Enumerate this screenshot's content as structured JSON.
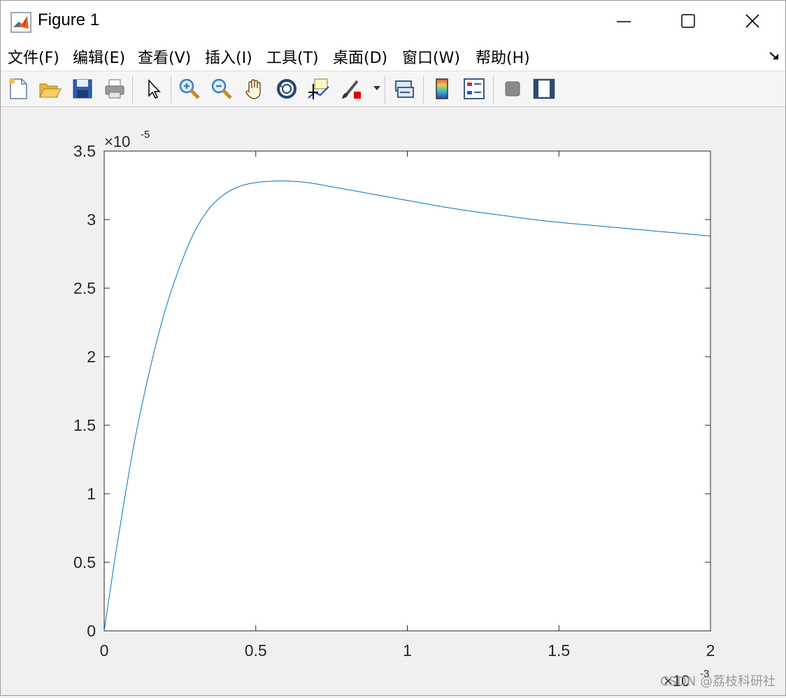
{
  "window": {
    "title": "Figure 1"
  },
  "menu": {
    "items": [
      {
        "label": "文件(F)"
      },
      {
        "label": "编辑(E)"
      },
      {
        "label": "查看(V)"
      },
      {
        "label": "插入(I)"
      },
      {
        "label": "工具(T)"
      },
      {
        "label": "桌面(D)"
      },
      {
        "label": "窗口(W)"
      },
      {
        "label": "帮助(H)"
      }
    ]
  },
  "toolbar": {
    "icons": [
      "new-figure-icon",
      "open-file-icon",
      "save-icon",
      "print-icon",
      "select-arrow-icon",
      "zoom-in-icon",
      "zoom-out-icon",
      "pan-hand-icon",
      "rotate-3d-icon",
      "data-cursor-icon",
      "brush-icon",
      "link-plot-icon",
      "colorbar-icon",
      "legend-icon",
      "hide-plot-tools-icon",
      "show-plot-tools-icon"
    ]
  },
  "watermark": "CSDN @荔枝科研社",
  "chart_data": {
    "type": "line",
    "title": "",
    "xlabel": "",
    "ylabel": "",
    "xlim": [
      0,
      0.002
    ],
    "ylim": [
      0,
      3.5e-05
    ],
    "x_exponent_label": "×10",
    "x_exponent": "-3",
    "y_exponent_label": "×10",
    "y_exponent": "-5",
    "x_tick_labels": [
      "0",
      "0.5",
      "1",
      "1.5",
      "2"
    ],
    "x_ticks": [
      0,
      0.0005,
      0.001,
      0.0015,
      0.002
    ],
    "y_tick_labels": [
      "0",
      "0.5",
      "1",
      "1.5",
      "2",
      "2.5",
      "3",
      "3.5"
    ],
    "y_ticks": [
      0,
      5e-06,
      1e-05,
      1.5e-05,
      2e-05,
      2.5e-05,
      3e-05,
      3.5e-05
    ],
    "grid": false,
    "line_color": "#0072bd",
    "series": [
      {
        "x": [
          0,
          2e-05,
          5e-05,
          0.0001,
          0.00015,
          0.0002,
          0.00025,
          0.0003,
          0.00035,
          0.0004,
          0.00045,
          0.0005,
          0.00055,
          0.0006,
          0.00065,
          0.0007,
          0.0008,
          0.0009,
          0.001,
          0.0011,
          0.0012,
          0.0013,
          0.0014,
          0.0015,
          0.0016,
          0.0017,
          0.0018,
          0.0019,
          0.002
        ],
        "values": [
          0,
          3e-06,
          7.3e-06,
          1.38e-05,
          1.9e-05,
          2.33e-05,
          2.66e-05,
          2.92e-05,
          3.09e-05,
          3.19e-05,
          3.245e-05,
          3.27e-05,
          3.28e-05,
          3.282e-05,
          3.275e-05,
          3.26e-05,
          3.22e-05,
          3.18e-05,
          3.14e-05,
          3.1e-05,
          3.065e-05,
          3.035e-05,
          3.005e-05,
          2.98e-05,
          2.96e-05,
          2.94e-05,
          2.92e-05,
          2.9e-05,
          2.88e-05
        ]
      }
    ]
  }
}
